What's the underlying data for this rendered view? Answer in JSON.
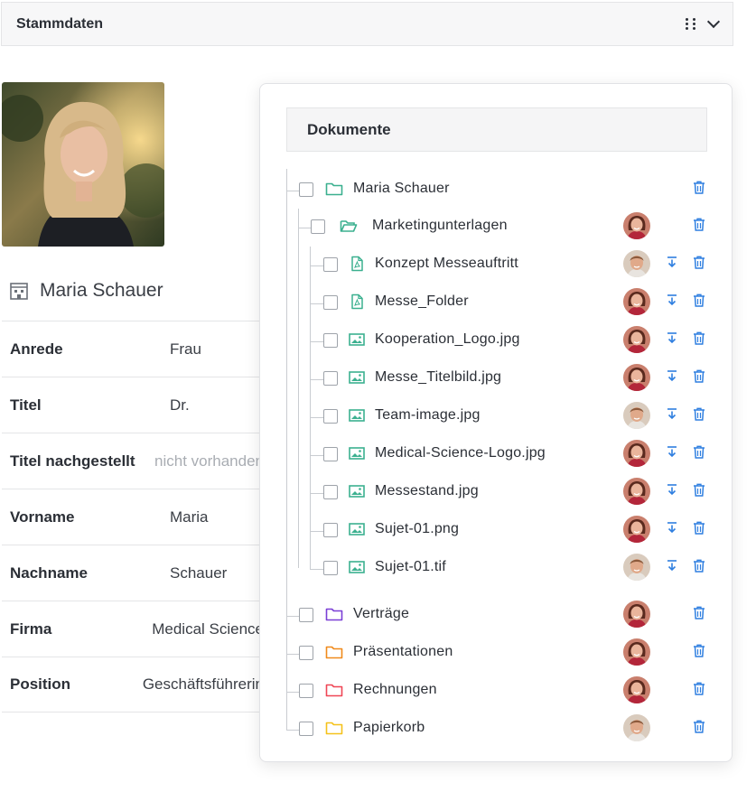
{
  "header": {
    "title": "Stammdaten"
  },
  "profile": {
    "name": "Maria Schauer",
    "fields": [
      {
        "label": "Anrede",
        "value": "Frau",
        "muted": false
      },
      {
        "label": "Titel",
        "value": "Dr.",
        "muted": false
      },
      {
        "label": "Titel nachgestellt",
        "value": "nicht vorhanden",
        "muted": true
      },
      {
        "label": "Vorname",
        "value": "Maria",
        "muted": false
      },
      {
        "label": "Nachname",
        "value": "Schauer",
        "muted": false
      },
      {
        "label": "Firma",
        "value": "Medical Science",
        "muted": false
      },
      {
        "label": "Position",
        "value": "Geschäftsführerin",
        "muted": false
      }
    ]
  },
  "documents": {
    "title": "Dokumente",
    "items": [
      {
        "label": "Maria Schauer",
        "type": "folder",
        "level": 0,
        "color": "#3bb08f",
        "avatar": null,
        "download": false
      },
      {
        "label": "Marketingunterlagen",
        "type": "folder-open",
        "level": 1,
        "color": "#3bb08f",
        "avatar": "female",
        "download": false
      },
      {
        "label": "Konzept Messeauftritt",
        "type": "pdf",
        "level": 2,
        "color": "#3bb08f",
        "avatar": "male",
        "download": true
      },
      {
        "label": "Messe_Folder",
        "type": "pdf",
        "level": 2,
        "color": "#3bb08f",
        "avatar": "female",
        "download": true
      },
      {
        "label": "Kooperation_Logo.jpg",
        "type": "image",
        "level": 2,
        "color": "#3bb08f",
        "avatar": "female",
        "download": true
      },
      {
        "label": "Messe_Titelbild.jpg",
        "type": "image",
        "level": 2,
        "color": "#3bb08f",
        "avatar": "female",
        "download": true
      },
      {
        "label": "Team-image.jpg",
        "type": "image",
        "level": 2,
        "color": "#3bb08f",
        "avatar": "male",
        "download": true
      },
      {
        "label": "Medical-Science-Logo.jpg",
        "type": "image",
        "level": 2,
        "color": "#3bb08f",
        "avatar": "female",
        "download": true
      },
      {
        "label": "Messestand.jpg",
        "type": "image",
        "level": 2,
        "color": "#3bb08f",
        "avatar": "female",
        "download": true
      },
      {
        "label": "Sujet-01.png",
        "type": "image",
        "level": 2,
        "color": "#3bb08f",
        "avatar": "female",
        "download": true
      },
      {
        "label": "Sujet-01.tif",
        "type": "image",
        "level": 2,
        "color": "#3bb08f",
        "avatar": "male",
        "download": true
      },
      {
        "label": "Verträge",
        "type": "folder",
        "level": 0,
        "color": "#7b3fd6",
        "avatar": "female",
        "download": false
      },
      {
        "label": "Präsentationen",
        "type": "folder",
        "level": 0,
        "color": "#f08a1c",
        "avatar": "female",
        "download": false
      },
      {
        "label": "Rechnungen",
        "type": "folder",
        "level": 0,
        "color": "#ef4756",
        "avatar": "female",
        "download": false
      },
      {
        "label": "Papierkorb",
        "type": "folder",
        "level": 0,
        "color": "#f5c21b",
        "avatar": "male",
        "download": false
      }
    ]
  },
  "colors": {
    "accent": "#2f7fe0",
    "file_icon": "#3bb08f"
  }
}
